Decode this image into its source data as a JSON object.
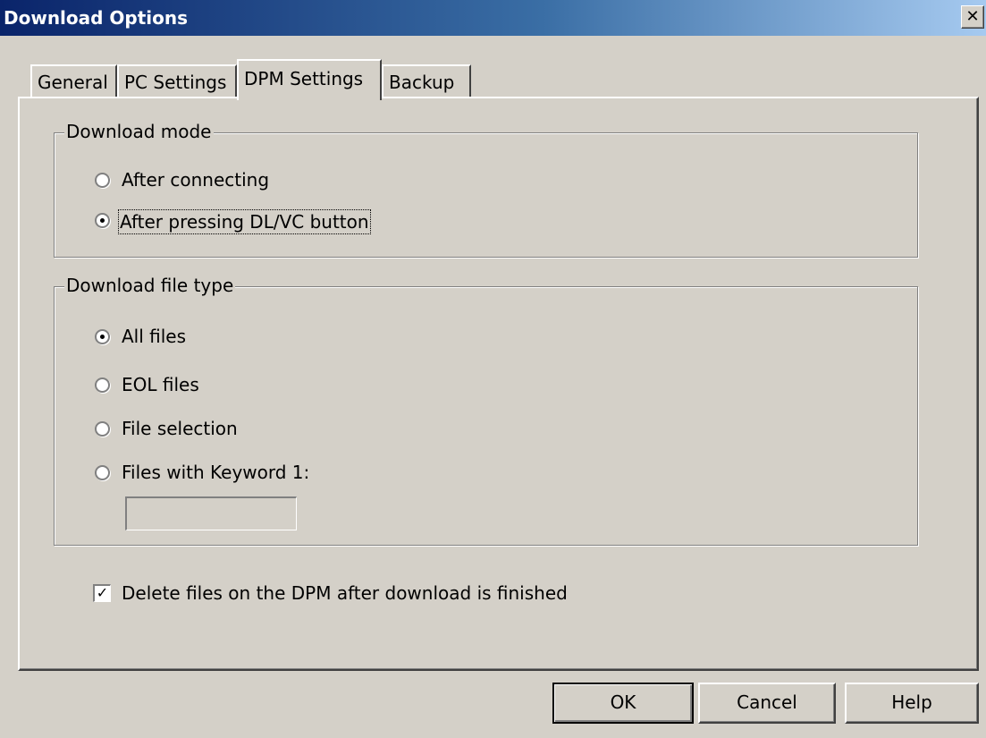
{
  "window": {
    "title": "Download Options",
    "close_glyph": "✕"
  },
  "tabs": [
    {
      "label": "General",
      "active": false
    },
    {
      "label": "PC Settings",
      "active": false
    },
    {
      "label": "DPM Settings",
      "active": true
    },
    {
      "label": "Backup",
      "active": false
    }
  ],
  "download_mode": {
    "label": "Download mode",
    "options": [
      {
        "label": "After connecting",
        "selected": false
      },
      {
        "label": "After pressing DL/VC button",
        "selected": true
      }
    ]
  },
  "download_file_type": {
    "label": "Download file type",
    "options": [
      {
        "label": "All files",
        "selected": true
      },
      {
        "label": "EOL files",
        "selected": false
      },
      {
        "label": "File selection",
        "selected": false
      },
      {
        "label": "Files with Keyword 1:",
        "selected": false
      }
    ],
    "keyword_value": ""
  },
  "delete_option": {
    "label": "Delete files on the DPM after download is finished",
    "checked": true,
    "check_glyph": "✓"
  },
  "buttons": {
    "ok": "OK",
    "cancel": "Cancel",
    "help": "Help"
  }
}
